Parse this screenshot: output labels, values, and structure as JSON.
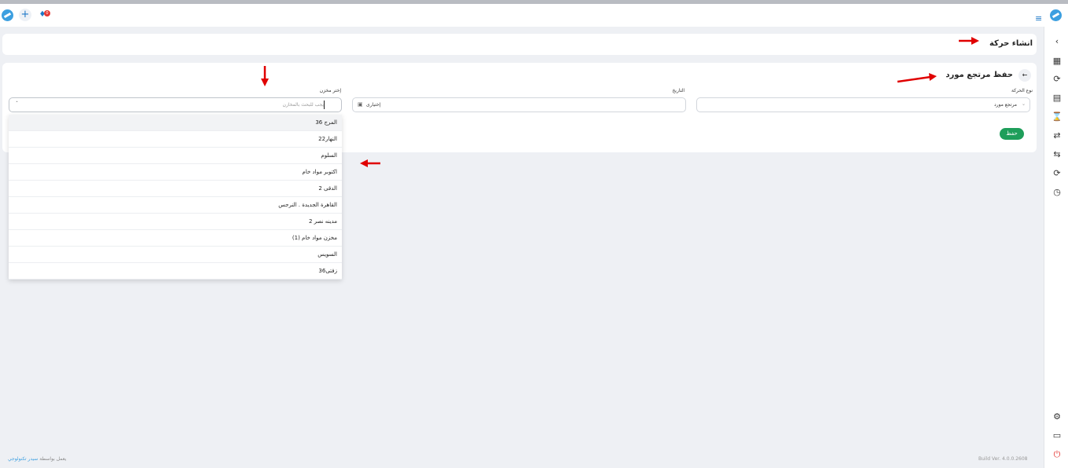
{
  "topbar": {
    "notification_count": "0"
  },
  "page": {
    "heading": "انشاء حركة"
  },
  "form": {
    "title": "حفظ مرتجع مورد",
    "movement_type_label": "نوع الحركة",
    "movement_type_value": "مرتجع مورد",
    "date_label": "التاريخ",
    "date_value": "إختيارى",
    "warehouse_label": "إختر مخزن",
    "warehouse_placeholder": "يجب للبحث بالمخازن",
    "save_label": "حفظ"
  },
  "warehouse_options": [
    "المرج 36",
    "النهار22",
    "السلوم",
    "اكتوبر مواد خام",
    "الدقى 2",
    "القاهرة الجديدة . النرجس",
    "مدينه نصر 2",
    "مخزن مواد خام (1)",
    "السويس",
    "زفتى36"
  ],
  "footer": {
    "powered_by": "يعمل بواسطة",
    "brand": "سيدر تكنولوجي",
    "build": "Build Ver. 4.0.0.2608"
  },
  "colors": {
    "accent": "#1e78c8",
    "save": "#1e9e5a",
    "annotation_arrow": "#e00000"
  }
}
